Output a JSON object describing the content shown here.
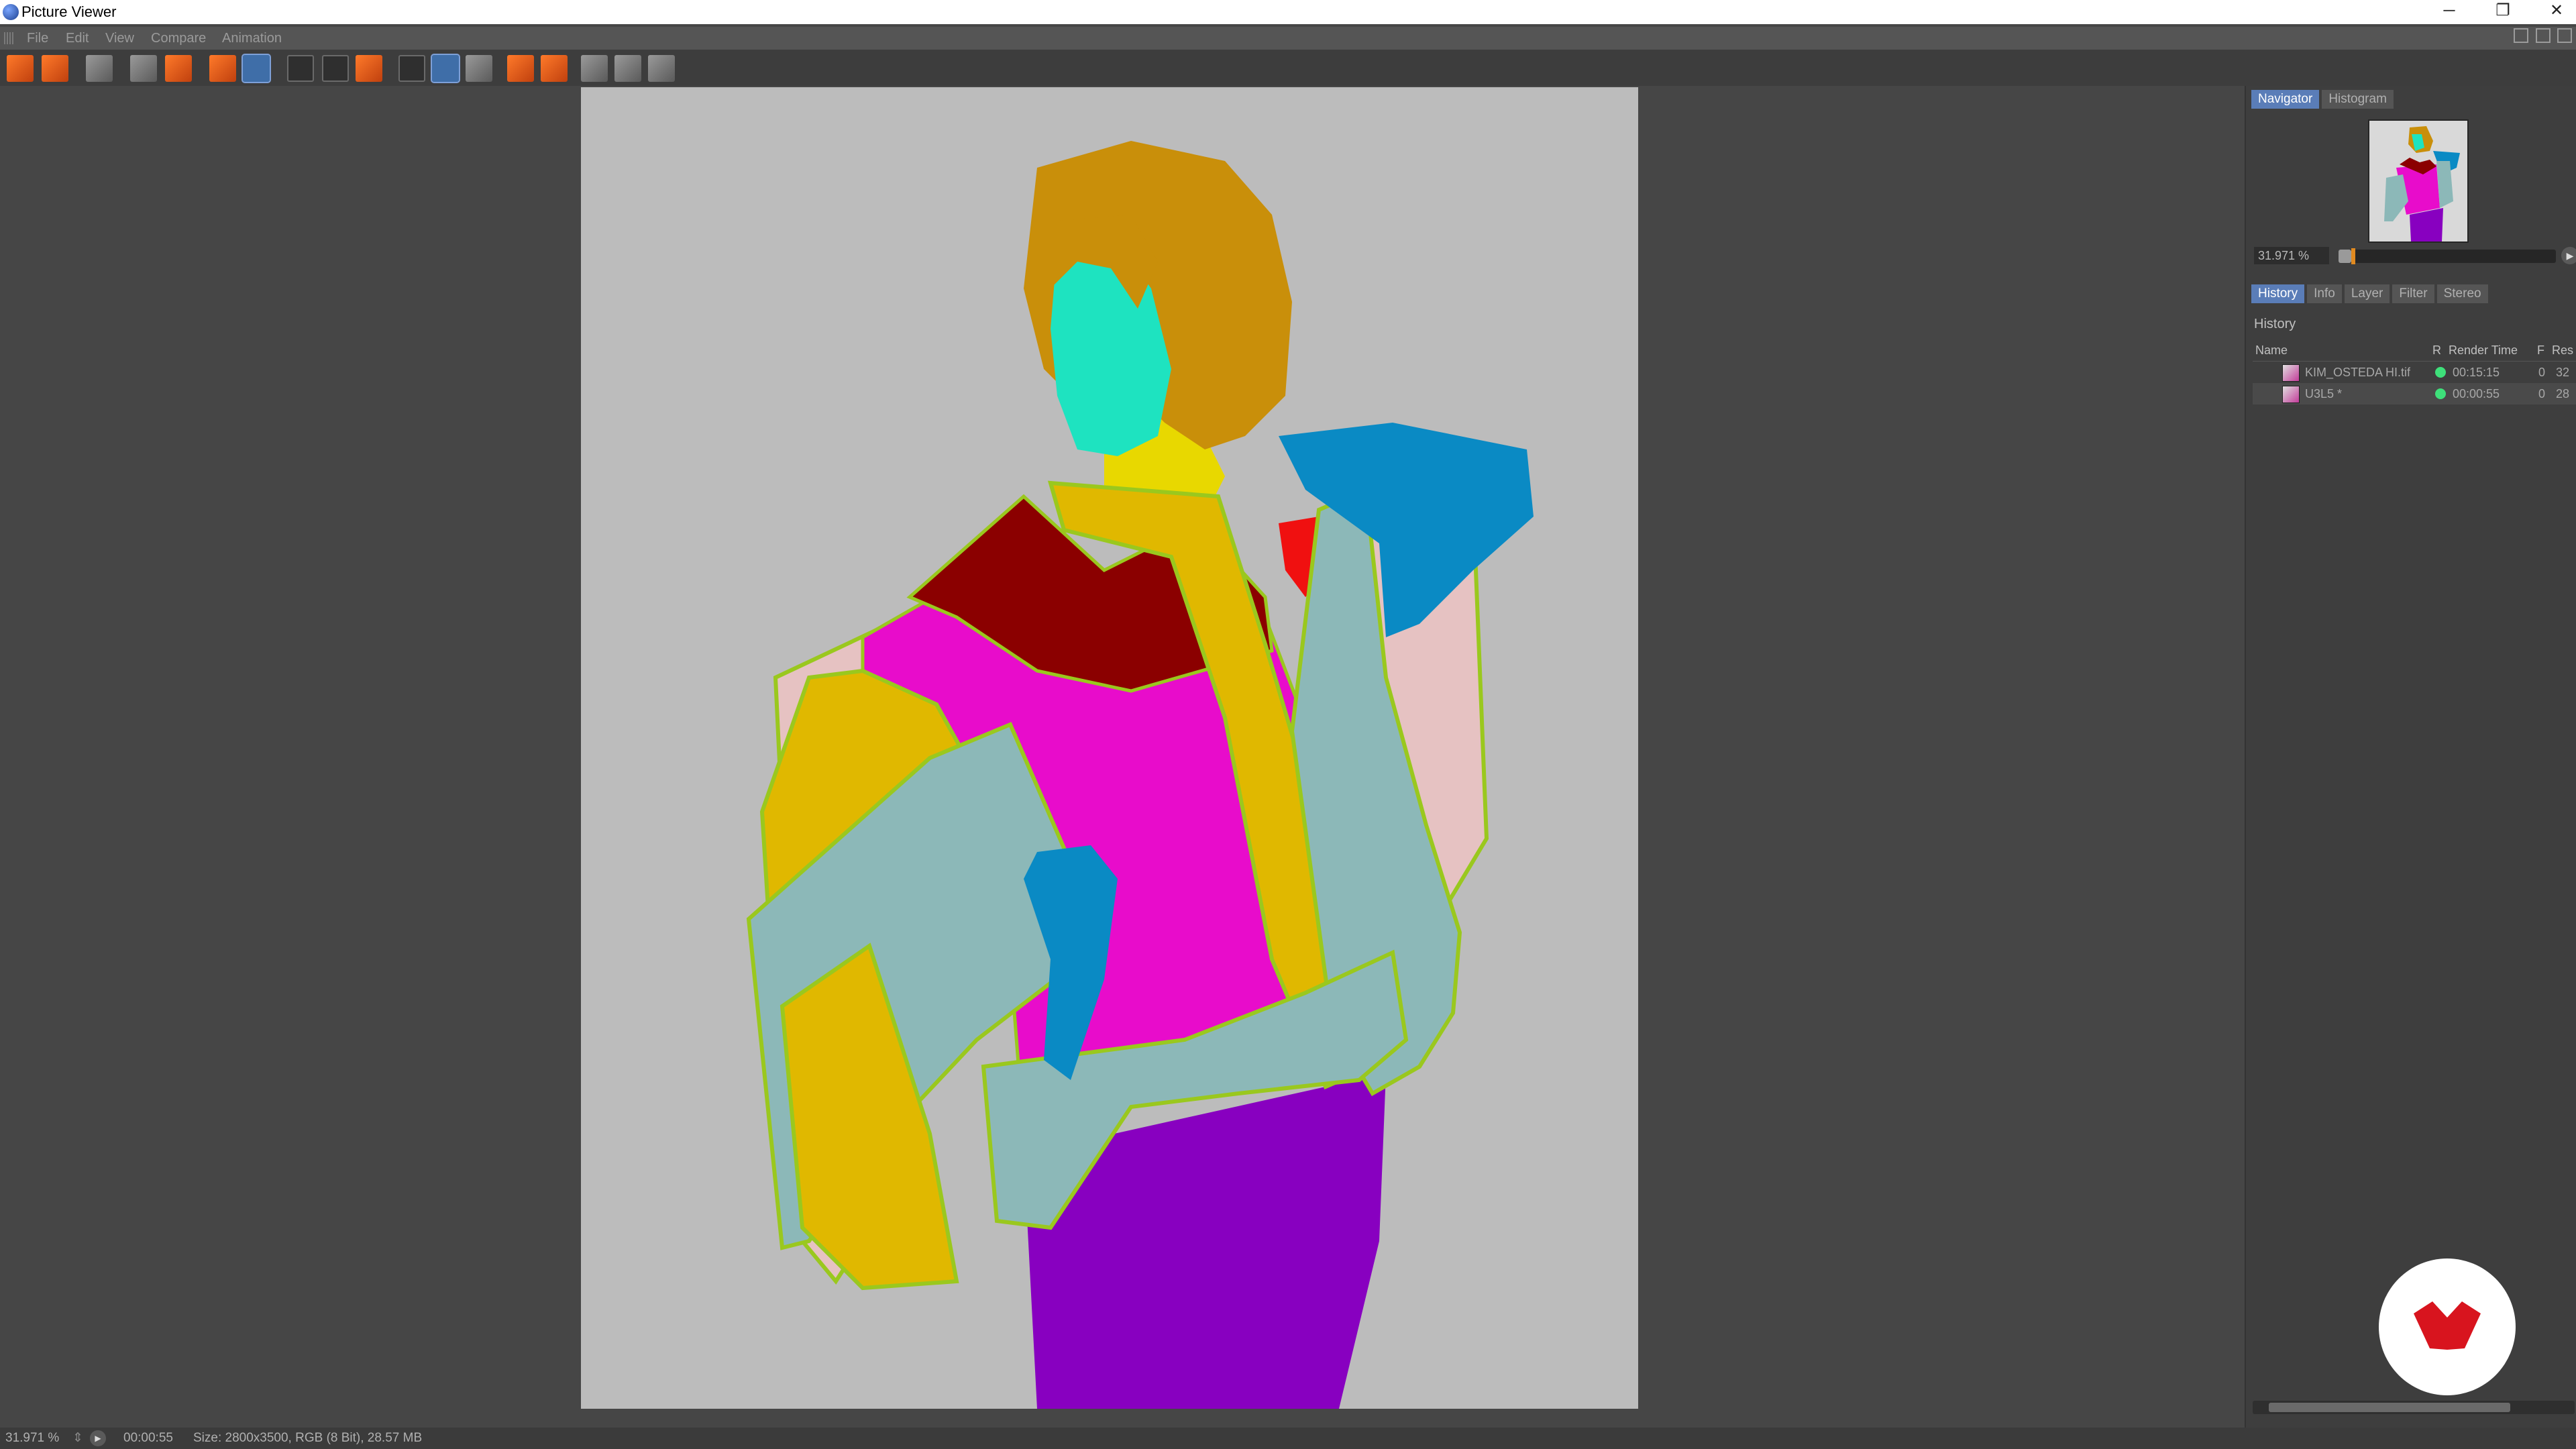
{
  "window": {
    "title": "Picture Viewer",
    "minimize": "─",
    "restore": "❐",
    "close": "✕"
  },
  "menu": [
    "File",
    "Edit",
    "View",
    "Compare",
    "Animation"
  ],
  "side_panel": {
    "top_tabs": [
      "Navigator",
      "Histogram"
    ],
    "zoom_value": "31.971 %",
    "zoom_fraction": 0.06,
    "bottom_tabs": [
      "History",
      "Info",
      "Layer",
      "Filter",
      "Stereo"
    ],
    "history_label": "History",
    "columns": [
      "Name",
      "R",
      "Render Time",
      "F",
      "Res"
    ],
    "rows": [
      {
        "name": "KIM_OSTEDA HI.tif",
        "time": "00:15:15",
        "frames": "0",
        "res": "32"
      },
      {
        "name": "U3L5 *",
        "time": "00:00:55",
        "frames": "0",
        "res": "28"
      }
    ]
  },
  "status": {
    "zoom": "31.971 %",
    "time": "00:00:55",
    "info": "Size: 2800x3500, RGB (8 Bit), 28.57 MB"
  },
  "colors": {
    "hair": "#c98f0a",
    "skin": "#1ee3c0",
    "neck": "#e8d800",
    "maroon": "#8b0000",
    "magenta": "#e80ccb",
    "yellow": "#e0b800",
    "teal_grey": "#8cb8b8",
    "pink": "#e6c2c2",
    "blue": "#0a8ac4",
    "red": "#f01010",
    "purple": "#8800c0",
    "outline": "#9ac81e",
    "logo_red": "#d8141e"
  }
}
